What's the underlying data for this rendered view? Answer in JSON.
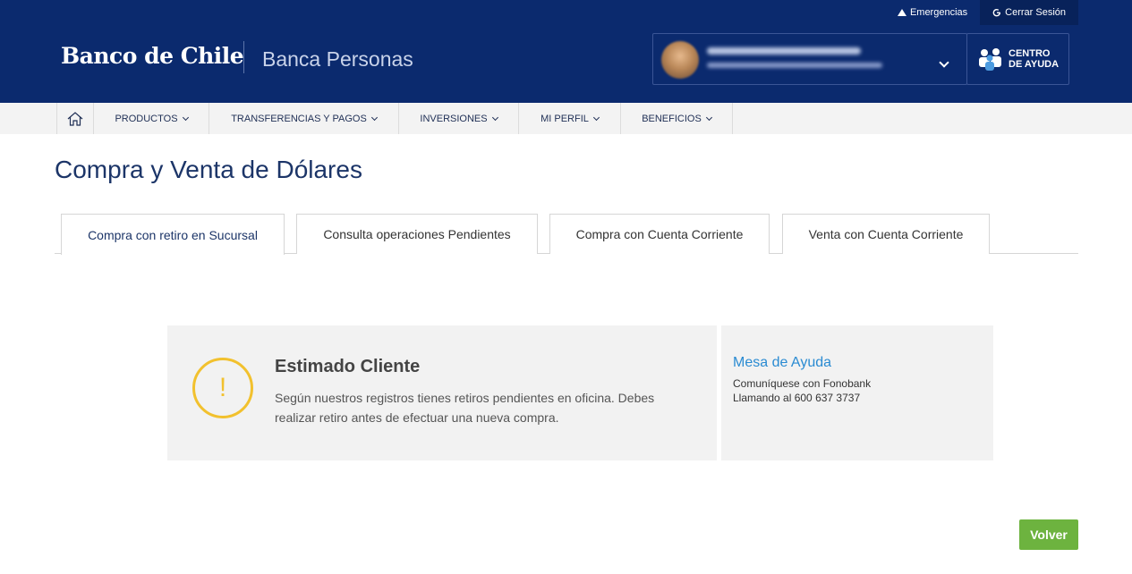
{
  "header": {
    "emergencias_label": "Emergencias",
    "cerrar_sesion_label": "Cerrar Sesión",
    "logo_text": "Banco de Chile",
    "section_name": "Banca Personas",
    "help_line1": "CENTRO",
    "help_line2": "DE AYUDA"
  },
  "nav": {
    "items": [
      {
        "label": "PRODUCTOS"
      },
      {
        "label": "TRANSFERENCIAS Y PAGOS"
      },
      {
        "label": "INVERSIONES"
      },
      {
        "label": "MI PERFIL"
      },
      {
        "label": "BENEFICIOS"
      }
    ]
  },
  "page": {
    "title": "Compra y Venta de Dólares"
  },
  "tabs": [
    {
      "label": "Compra con retiro en Sucursal",
      "active": true
    },
    {
      "label": "Consulta operaciones Pendientes",
      "active": false
    },
    {
      "label": "Compra con Cuenta Corriente",
      "active": false
    },
    {
      "label": "Venta con Cuenta Corriente",
      "active": false
    }
  ],
  "message": {
    "icon_text": "!",
    "title": "Estimado Cliente",
    "body": "Según nuestros registros tienes retiros pendientes en oficina. Debes realizar retiro antes de efectuar una nueva compra."
  },
  "help_panel": {
    "title": "Mesa de Ayuda",
    "line1": "Comuníquese con Fonobank",
    "line2": "Llamando al 600 637 3737"
  },
  "actions": {
    "volver_label": "Volver"
  },
  "colors": {
    "header_bg": "#0b2a6e",
    "accent_green": "#6db33f",
    "warning_yellow": "#f2c12e",
    "link_blue": "#2a8bd2"
  }
}
